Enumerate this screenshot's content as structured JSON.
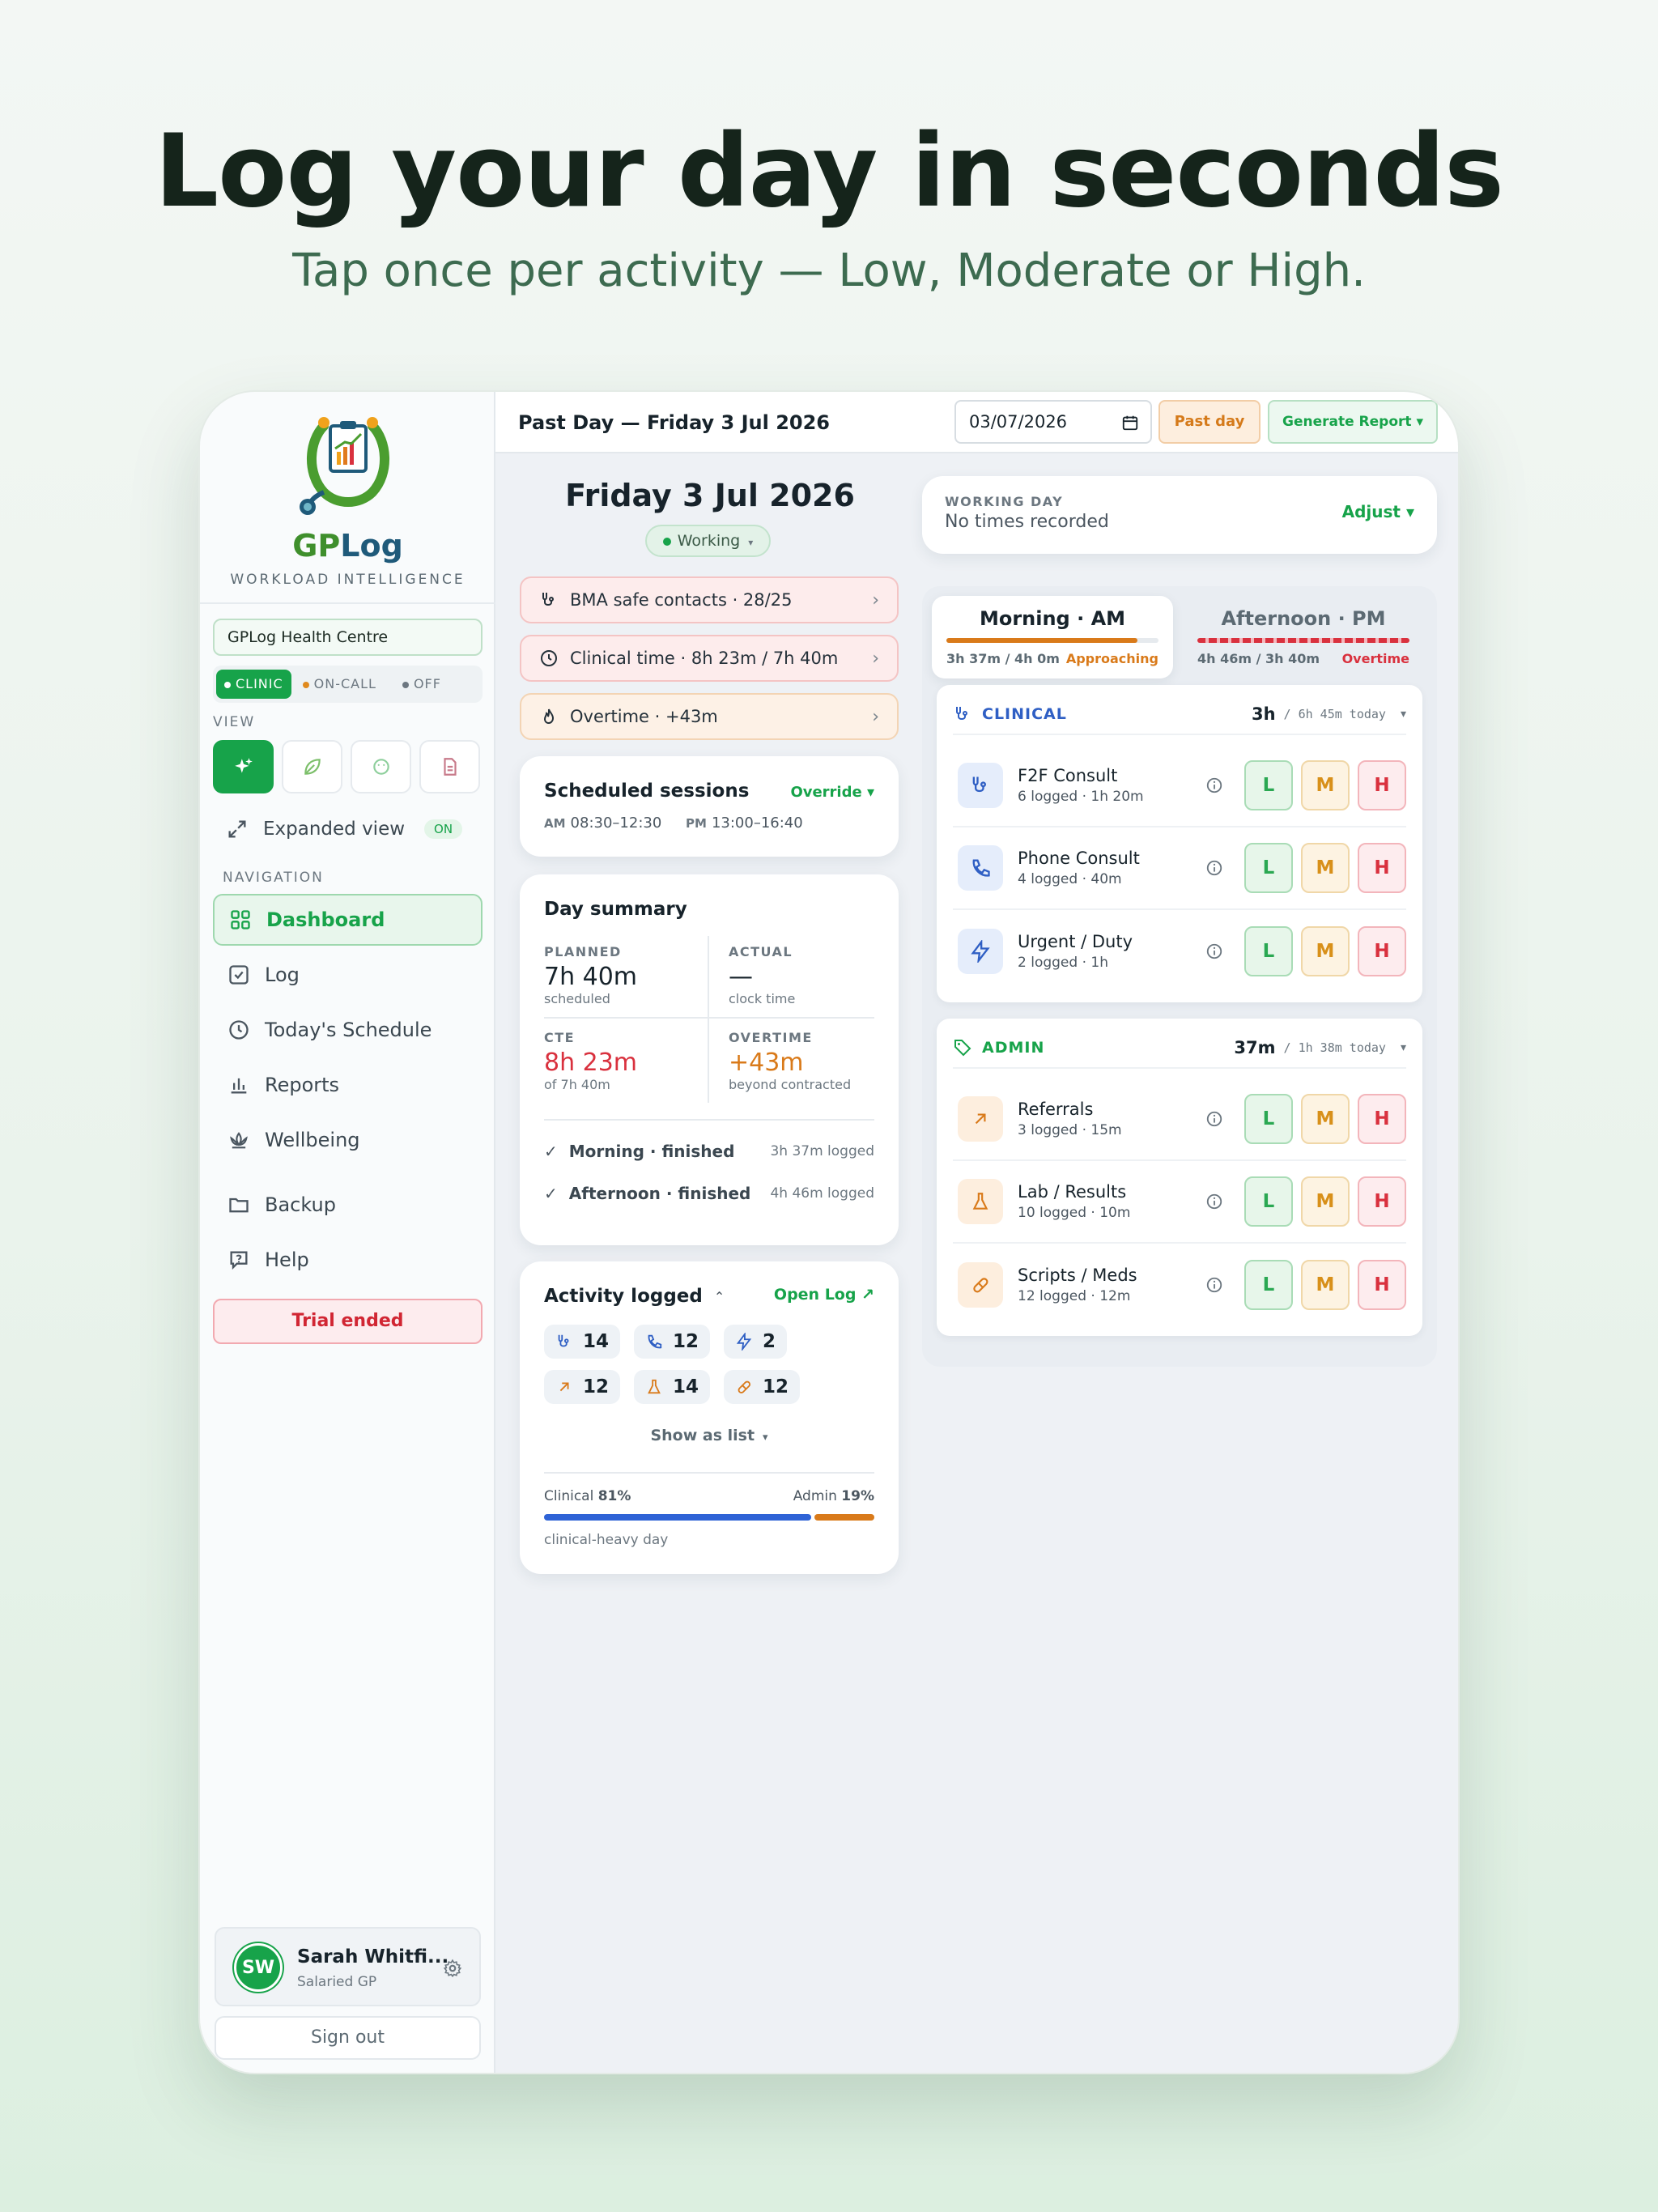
{
  "hero": {
    "title": "Log your day in seconds",
    "subtitle": "Tap once per activity — Low, Moderate or High."
  },
  "sidebar": {
    "brand_gp": "GP",
    "brand_log": "Log",
    "tagline": "WORKLOAD INTELLIGENCE",
    "practice": "GPLog Health Centre",
    "modes": [
      {
        "label": "CLINIC",
        "dot_color": "#ffffff",
        "active": true
      },
      {
        "label": "ON-CALL",
        "dot_color": "#e08a1e",
        "active": false
      },
      {
        "label": "OFF",
        "dot_color": "#6c7780",
        "active": false
      }
    ],
    "view_label": "VIEW",
    "expanded_label": "Expanded view",
    "expanded_state": "ON",
    "nav_label": "NAVIGATION",
    "nav": [
      {
        "label": "Dashboard",
        "icon": "grid-icon"
      },
      {
        "label": "Log",
        "icon": "checkbox-icon"
      },
      {
        "label": "Today's Schedule",
        "icon": "clock-icon"
      },
      {
        "label": "Reports",
        "icon": "bar-chart-icon"
      },
      {
        "label": "Wellbeing",
        "icon": "lotus-icon"
      },
      {
        "label": "Backup",
        "icon": "folder-icon"
      },
      {
        "label": "Help",
        "icon": "help-icon"
      }
    ],
    "trial": "Trial ended",
    "user": {
      "initials": "SW",
      "name": "Sarah Whitfi...",
      "role": "Salaried GP"
    },
    "signout": "Sign out"
  },
  "topbar": {
    "title": "Past Day — Friday 3 Jul 2026",
    "date_value": "03/07/2026",
    "past_day": "Past day",
    "generate": "Generate Report ▾"
  },
  "day": {
    "title": "Friday 3 Jul 2026",
    "status": "Working",
    "alerts": [
      {
        "text": "BMA safe contacts · 28/25",
        "icon": "stethoscope-icon",
        "bg": "#fdecec",
        "border": "#f4c4c4"
      },
      {
        "text": "Clinical time · 8h 23m / 7h 40m",
        "icon": "clock-icon",
        "bg": "#fdecec",
        "border": "#f4c4c4"
      },
      {
        "text": "Overtime · +43m",
        "icon": "flame-icon",
        "bg": "#fdf1e6",
        "border": "#f3d4b4"
      }
    ]
  },
  "sessions": {
    "title": "Scheduled sessions",
    "override": "Override ▾",
    "am_label": "AM",
    "am_time": "08:30–12:30",
    "pm_label": "PM",
    "pm_time": "13:00–16:40"
  },
  "summary": {
    "title": "Day summary",
    "planned_label": "PLANNED",
    "planned_value": "7h 40m",
    "planned_sub": "scheduled",
    "actual_label": "ACTUAL",
    "actual_value": "—",
    "actual_sub": "clock time",
    "cte_label": "CTE",
    "cte_value": "8h 23m",
    "cte_sub": "of 7h 40m",
    "overtime_label": "OVERTIME",
    "overtime_value": "+43m",
    "overtime_sub": "beyond contracted",
    "morning": "Morning · finished",
    "morning_logged": "3h 37m logged",
    "afternoon": "Afternoon · finished",
    "afternoon_logged": "4h 46m logged"
  },
  "activity": {
    "title": "Activity logged",
    "open_log": "Open Log ↗",
    "counts": [
      {
        "icon": "stethoscope-icon",
        "value": "14",
        "color": "#2f5fc4"
      },
      {
        "icon": "phone-icon",
        "value": "12",
        "color": "#2f5fc4"
      },
      {
        "icon": "bolt-icon",
        "value": "2",
        "color": "#2f5fc4"
      },
      {
        "icon": "arrow-up-right-icon",
        "value": "12",
        "color": "#d97a1a"
      },
      {
        "icon": "flask-icon",
        "value": "14",
        "color": "#d97a1a"
      },
      {
        "icon": "pill-icon",
        "value": "12",
        "color": "#d97a1a"
      }
    ],
    "show_list": "Show as list",
    "clinical_label": "Clinical",
    "clinical_pct": "81%",
    "admin_label": "Admin",
    "admin_pct": "19%",
    "clinical_fraction": 0.81,
    "split_note": "clinical-heavy day"
  },
  "working_day": {
    "label": "WORKING DAY",
    "value": "No times recorded",
    "adjust": "Adjust ▾"
  },
  "tabs": [
    {
      "title": "Morning · AM",
      "meta": "3h 37m / 4h 0m",
      "status": "Approaching",
      "status_color": "#d97a1a",
      "progress": 0.9
    },
    {
      "title": "Afternoon · PM",
      "meta": "4h 46m / 3h 40m",
      "status": "Overtime",
      "status_color": "#d9313e",
      "progress": 1.0
    }
  ],
  "clinical": {
    "name": "CLINICAL",
    "total": "3h",
    "today": "/ 6h 45m today",
    "items": [
      {
        "name": "F2F Consult",
        "meta": "6 logged · 1h 20m",
        "icon": "stethoscope-icon"
      },
      {
        "name": "Phone Consult",
        "meta": "4 logged · 40m",
        "icon": "phone-icon"
      },
      {
        "name": "Urgent / Duty",
        "meta": "2 logged · 1h",
        "icon": "bolt-icon"
      }
    ]
  },
  "admin": {
    "name": "ADMIN",
    "total": "37m",
    "today": "/ 1h 38m today",
    "items": [
      {
        "name": "Referrals",
        "meta": "3 logged · 15m",
        "icon": "arrow-up-right-icon"
      },
      {
        "name": "Lab / Results",
        "meta": "10 logged · 10m",
        "icon": "flask-icon"
      },
      {
        "name": "Scripts / Meds",
        "meta": "12 logged · 12m",
        "icon": "pill-icon"
      }
    ]
  },
  "lmh": {
    "l": "L",
    "m": "M",
    "h": "H"
  },
  "colors": {
    "accent": "#17a34a",
    "clinical": "#2f5fc4",
    "admin": "#d97a1a",
    "danger": "#d9313e"
  }
}
